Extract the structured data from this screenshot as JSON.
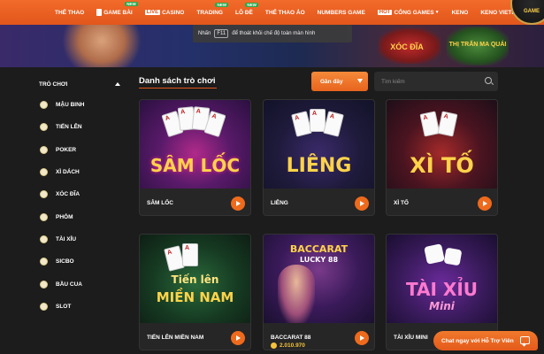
{
  "nav": {
    "items": [
      {
        "label": "THỂ THAO"
      },
      {
        "label": "GAME BÀI",
        "new": "NEW"
      },
      {
        "live": "LIVE",
        "label": "CASINO"
      },
      {
        "label": "TRADING",
        "new": "NEW"
      },
      {
        "label": "LÔ ĐỀ",
        "new": "NEW"
      },
      {
        "label": "THỂ THAO ẢO"
      },
      {
        "label": "NUMBERS GAME"
      },
      {
        "hot": "HOT",
        "label": "CỔNG GAMES"
      },
      {
        "label": "KENO"
      },
      {
        "label": "KENO VIETLOTT"
      }
    ]
  },
  "banner": {
    "promo_a": "XÓC ĐĨA",
    "promo_b": "THỊ TRẤN MA QUÁI",
    "corner": "GAME"
  },
  "fullscreen_tip": {
    "prefix": "Nhấn",
    "key": "F11",
    "suffix": "để thoát khỏi chế độ toàn màn hình"
  },
  "sidebar": {
    "heading": "TRÒ CHƠI",
    "items": [
      {
        "label": "MẬU BINH"
      },
      {
        "label": "TIẾN LÊN"
      },
      {
        "label": "POKER"
      },
      {
        "label": "XÌ DÁCH"
      },
      {
        "label": "XÓC ĐĨA"
      },
      {
        "label": "PHỎM"
      },
      {
        "label": "TÀI XỈU"
      },
      {
        "label": "SICBO"
      },
      {
        "label": "BẦU CUA"
      },
      {
        "label": "SLOT"
      }
    ]
  },
  "main": {
    "title": "Danh sách trò chơi",
    "sort_label": "Gần đây",
    "search_placeholder": "Tìm kiếm"
  },
  "games": [
    {
      "name": "SÂM LỐC",
      "art_title": "SÂM LỐC"
    },
    {
      "name": "LIÊNG",
      "art_title": "LIÊNG"
    },
    {
      "name": "XÌ TỐ",
      "art_title": "XÌ TỐ"
    },
    {
      "name": "TIẾN LÊN MIỀN NAM",
      "art_title_1": "Tiến lên",
      "art_title_2": "MIỀN NAM"
    },
    {
      "name": "BACCARAT 88",
      "art_title_1": "BACCARAT",
      "art_title_2": "LUCKY 88",
      "jackpot": "2.010.970"
    },
    {
      "name": "TÀI XỈU MINI",
      "art_title_1": "TÀI XỈU",
      "art_title_2": "Mini"
    }
  ],
  "chat": {
    "label": "Chat ngay với Hỗ Trợ Viên"
  },
  "colors": {
    "accent": "#e2561b",
    "background": "#1c1c1c",
    "card_background": "#262626"
  }
}
